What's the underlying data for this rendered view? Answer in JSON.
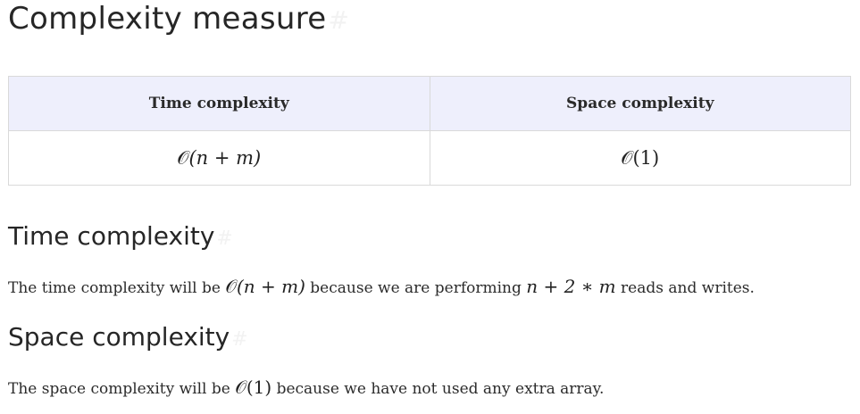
{
  "main_heading": "Complexity measure",
  "anchor_symbol": "#",
  "table": {
    "headers": [
      "Time complexity",
      "Space complexity"
    ],
    "row": {
      "time": {
        "o": "𝒪",
        "inner": "(n + m)"
      },
      "space": {
        "o": "𝒪",
        "inner": "(1)"
      }
    }
  },
  "time_section": {
    "heading": "Time complexity",
    "text_before": "The time complexity will be ",
    "math1_o": "𝒪",
    "math1_inner": "(n + m)",
    "text_middle": " because we are performing ",
    "math2": "n + 2 ∗ m",
    "text_after": " reads and writes."
  },
  "space_section": {
    "heading": "Space complexity",
    "text_before": "The space complexity will be ",
    "math_o": "𝒪",
    "math_inner": "(1)",
    "text_after": " because we have not used any extra array."
  }
}
